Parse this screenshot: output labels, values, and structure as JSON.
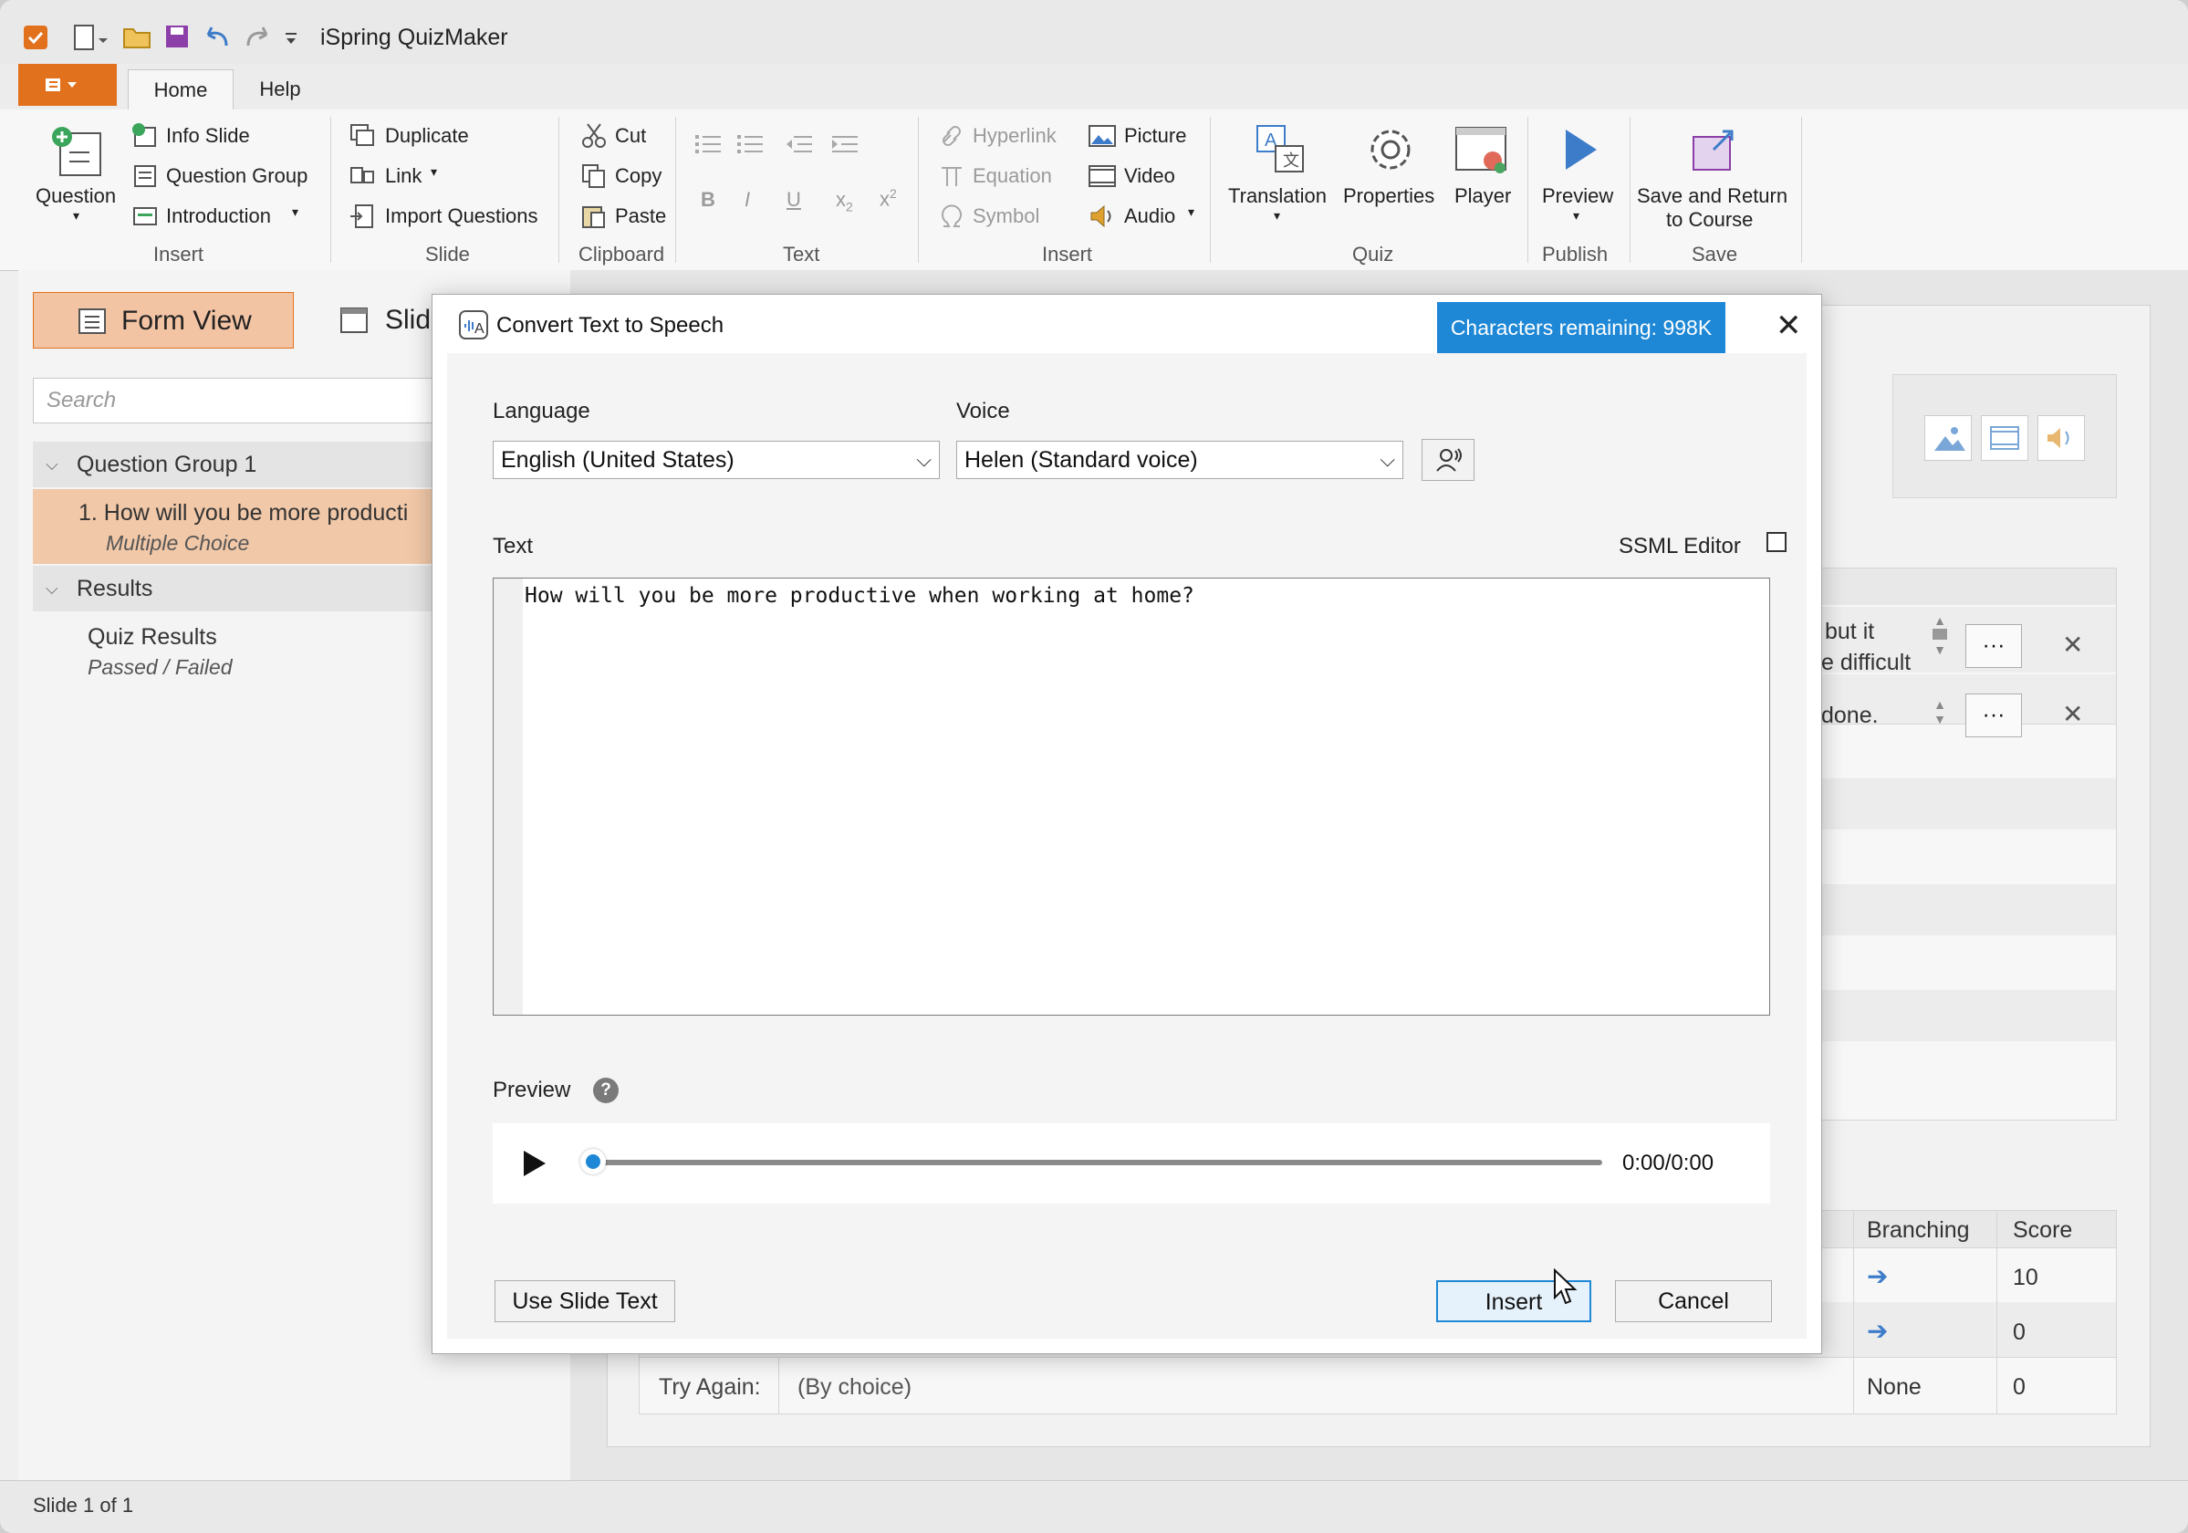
{
  "app": {
    "title": "iSpring QuizMaker"
  },
  "tabs": {
    "home": "Home",
    "help": "Help"
  },
  "ribbon": {
    "insert_group": {
      "question": "Question",
      "info_slide": "Info Slide",
      "question_group": "Question Group",
      "introduction": "Introduction",
      "label": "Insert"
    },
    "slide_group": {
      "duplicate": "Duplicate",
      "link": "Link",
      "import_questions": "Import Questions",
      "label": "Slide"
    },
    "clipboard_group": {
      "cut": "Cut",
      "copy": "Copy",
      "paste": "Paste",
      "label": "Clipboard"
    },
    "text_group": {
      "label": "Text"
    },
    "insert2_group": {
      "hyperlink": "Hyperlink",
      "equation": "Equation",
      "symbol": "Symbol",
      "picture": "Picture",
      "video": "Video",
      "audio": "Audio",
      "label": "Insert"
    },
    "quiz_group": {
      "translation": "Translation",
      "properties": "Properties",
      "player": "Player",
      "label": "Quiz"
    },
    "publish_group": {
      "preview": "Preview",
      "label": "Publish"
    },
    "save_group": {
      "save_return_1": "Save and Return",
      "save_return_2": "to Course",
      "label": "Save"
    }
  },
  "left_panel": {
    "form_view": "Form View",
    "slide_view": "Slid",
    "search_placeholder": "Search",
    "tree": {
      "group1": "Question Group 1",
      "q1_title": "1.  How will you be more producti",
      "q1_type": "Multiple Choice",
      "results": "Results",
      "quiz_results": "Quiz Results",
      "quiz_results_sub": "Passed / Failed"
    }
  },
  "background_editor": {
    "answer1_line1": "but it",
    "answer1_line2": "e difficult",
    "answer2": "done.",
    "ellipsis": "···",
    "branching_header": "Branching",
    "score_header": "Score",
    "score1": "10",
    "score2": "0",
    "try_again_label": "Try Again:",
    "try_again_value": "(By choice)",
    "try_again_branch": "None",
    "try_again_score": "0"
  },
  "dialog": {
    "title": "Convert Text to Speech",
    "chars_remaining": "Characters remaining: 998K",
    "language_label": "Language",
    "language_value": "English (United States)",
    "voice_label": "Voice",
    "voice_value": "Helen (Standard voice)",
    "text_label": "Text",
    "ssml_label": "SSML Editor",
    "text_value": "How will you be more productive when working at home?",
    "preview_label": "Preview",
    "help_glyph": "?",
    "time": "0:00/0:00",
    "progress": 0,
    "use_slide_text": "Use Slide Text",
    "insert": "Insert",
    "cancel": "Cancel"
  },
  "status": {
    "slide_info": "Slide 1 of 1"
  },
  "colors": {
    "accent_orange": "#e2711d",
    "selection": "#f1c8a8",
    "dialog_blue": "#1e88d6"
  }
}
